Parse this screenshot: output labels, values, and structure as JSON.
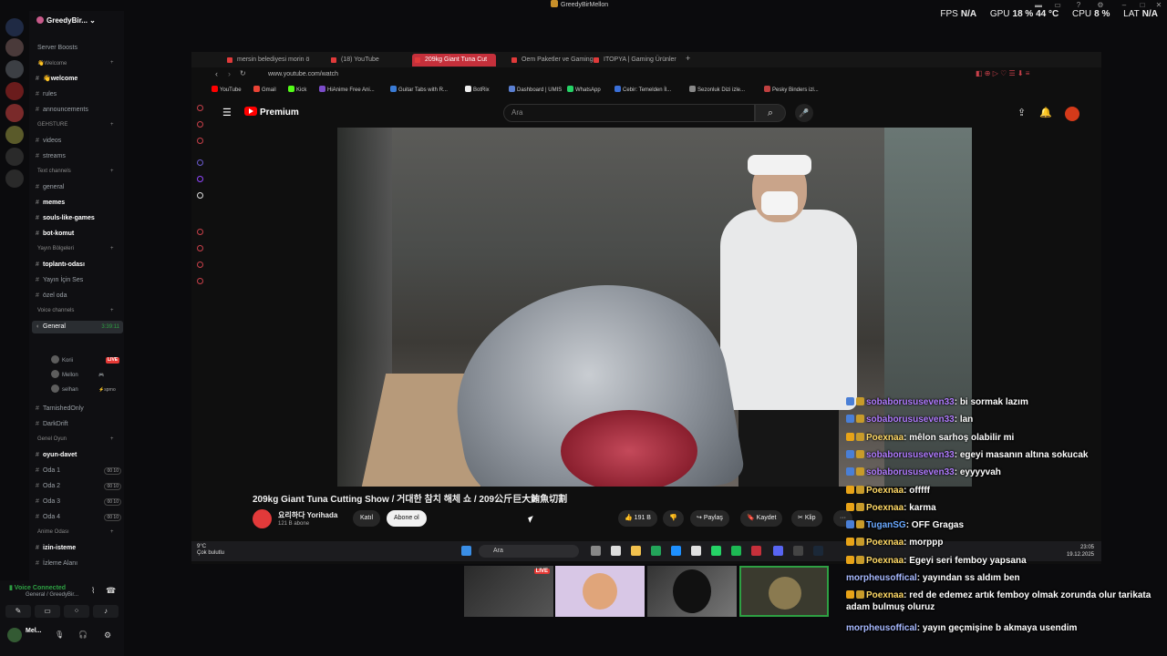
{
  "window_title": "GreedyBirMellon",
  "perf": {
    "fps_label": "FPS",
    "fps": "N/A",
    "gpu_label": "GPU",
    "gpu": "18 % 44 °C",
    "cpu_label": "CPU",
    "cpu": "8 %",
    "lat_label": "LAT",
    "lat": "N/A"
  },
  "discord": {
    "server_name": "GreedyBir...",
    "channels": [
      {
        "t": "cat",
        "label": "Server Boosts"
      },
      {
        "t": "cat2",
        "label": "👋Welcome"
      },
      {
        "t": "ch",
        "label": "👋welcome",
        "active": true
      },
      {
        "t": "ch",
        "label": "rules"
      },
      {
        "t": "ch",
        "label": "announcements"
      },
      {
        "t": "cat2",
        "label": "GEHSTURE"
      },
      {
        "t": "ch",
        "label": "videos"
      },
      {
        "t": "ch",
        "label": "streams"
      },
      {
        "t": "cat2",
        "label": "Text channels"
      },
      {
        "t": "ch",
        "label": "general"
      },
      {
        "t": "ch",
        "label": "memes",
        "active": true
      },
      {
        "t": "ch",
        "label": "souls-like-games",
        "active": true
      },
      {
        "t": "ch",
        "label": "bot-komut",
        "active": true
      },
      {
        "t": "cat2",
        "label": "Yayın Bölgeleri"
      },
      {
        "t": "ch",
        "label": "toplantı-odası",
        "active": true
      },
      {
        "t": "ch",
        "label": "Yayın İçin Ses"
      },
      {
        "t": "ch",
        "label": "özel oda"
      },
      {
        "t": "cat2",
        "label": "Voice channels"
      },
      {
        "t": "ch",
        "label": "General",
        "selected": true,
        "time": "3:39:11"
      }
    ],
    "voice_users": [
      {
        "name": "Korii",
        "live": "LIVE"
      },
      {
        "name": "Mellon",
        "extra": "🎮"
      },
      {
        "name": "selhan",
        "extra": "⚡sprno"
      }
    ],
    "channels2": [
      {
        "t": "ch",
        "label": "TarnishedOnly"
      },
      {
        "t": "ch",
        "label": "DarkDrift"
      },
      {
        "t": "cat2",
        "label": "Genel Oyun"
      },
      {
        "t": "ch",
        "label": "oyun-davet",
        "active": true
      },
      {
        "t": "ch",
        "label": "Oda 1",
        "badge": "00 10"
      },
      {
        "t": "ch",
        "label": "Oda 2",
        "badge": "00 10"
      },
      {
        "t": "ch",
        "label": "Oda 3",
        "badge": "00 10"
      },
      {
        "t": "ch",
        "label": "Oda 4",
        "badge": "00 10"
      },
      {
        "t": "cat2",
        "label": "Anime Odası"
      },
      {
        "t": "ch",
        "label": "izin-isteme",
        "active": true
      },
      {
        "t": "ch",
        "label": "İzleme Alanı"
      }
    ],
    "voice_connected": "Voice Connected",
    "voice_channel": "General / GreedyBir...",
    "user": "Mel..."
  },
  "browser": {
    "tabs": [
      "mersin belediyesi morin ö",
      "(18) YouTube",
      "209kg Giant Tuna Cut",
      "Oem Paketler ve Gaming",
      "ITOPYA | Gaming Ürünler"
    ],
    "url": "www.youtube.com/watch",
    "bookmarks": [
      "YouTube",
      "Gmail",
      "Kick",
      "HiAnime Free Ani...",
      "Guitar Tabs with R...",
      "BotRix",
      "Dashboard | UMIS",
      "WhatsApp",
      "Cebir: Temelden İl...",
      "Sezonluk Dizi izle...",
      "Pesky Binders izl..."
    ]
  },
  "youtube": {
    "logo": "Premium",
    "search_placeholder": "Ara",
    "title": "209kg Giant Tuna Cutting Show / 거대한 참치 해체 쇼 / 209公斤巨大鮪魚切割",
    "channel": "요리하다 Yorihada",
    "subs": "121 B abone",
    "join": "Katıl",
    "subscribe": "Abone ol",
    "likes": "191 B",
    "share": "Paylaş",
    "save": "Kaydet",
    "clip": "Klip"
  },
  "taskbar": {
    "weather_temp": "9°C",
    "weather_desc": "Çok bulutlu",
    "search": "Ara",
    "time": "23:05",
    "date": "19.12.2025"
  },
  "streams": {
    "live": "LIVE"
  },
  "chat": [
    {
      "user": "sobaborususeven33",
      "text": ": bi sormak lazım",
      "c": "u1"
    },
    {
      "user": "sobaborususeven33",
      "text": ": lan",
      "c": "u1"
    },
    {
      "user": "Poexnaa",
      "text": ": mêlon sarhoş olabilir mi",
      "c": "u2"
    },
    {
      "user": "sobaborususeven33",
      "text": ": egeyi masanın altına sokucak",
      "c": "u1"
    },
    {
      "user": "sobaborususeven33",
      "text": ": eyyyyvah",
      "c": "u1"
    },
    {
      "user": "Poexnaa",
      "text": ": offfff",
      "c": "u2"
    },
    {
      "user": "Poexnaa",
      "text": ": karma",
      "c": "u2"
    },
    {
      "user": "TuganSG",
      "text": ": OFF Gragas",
      "c": "u3"
    },
    {
      "user": "Poexnaa",
      "text": ": morppp",
      "c": "u2"
    },
    {
      "user": "Poexnaa",
      "text": ": Egeyi seri femboy yapsana",
      "c": "u2"
    },
    {
      "user": "morpheusoffical",
      "text": ": yayından ss aldım ben",
      "c": "u4"
    },
    {
      "user": "Poexnaa",
      "text": ": red de edemez artık femboy olmak zorunda olur tarikata adam bulmuş oluruz",
      "c": "u2"
    },
    {
      "user": "morpheusoffical",
      "text": ": yayın geçmişine b akmaya usendim",
      "c": "u4"
    }
  ]
}
